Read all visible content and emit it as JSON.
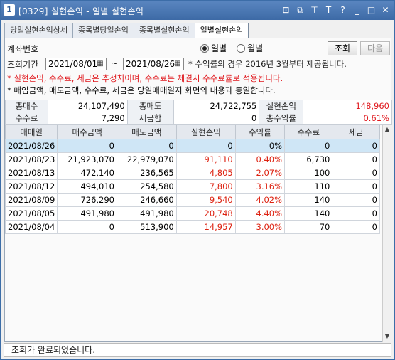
{
  "window": {
    "number": "1",
    "title": "[0329] 실현손익 - 일별 실현손익"
  },
  "tabs": [
    "당일실현손익상세",
    "종목별당일손익",
    "종목별실현손익",
    "일별실현손익"
  ],
  "form": {
    "account_label": "계좌번호",
    "period_label": "조회기간",
    "date_from": "2021/08/01",
    "date_to": "2021/08/26",
    "tilde": "~",
    "period_note": "* 수익률의 경우 2016년 3월부터 제공됩니다.",
    "radio_daily": "일별",
    "radio_monthly": "월별",
    "query_button": "조회",
    "next_button": "다음"
  },
  "notes": {
    "red": "* 실현손익, 수수료, 세금은 추정치이며, 수수료는 체결시 수수료률로 적용됩니다.",
    "normal": "* 매입금액, 매도금액, 수수료, 세금은 당일매매일지 화면의 내용과 동일합니다."
  },
  "summary": {
    "total_buy_label": "총매수",
    "total_buy": "24,107,490",
    "total_sell_label": "총매도",
    "total_sell": "24,722,755",
    "realized_label": "실현손익",
    "realized": "148,960",
    "fee_label": "수수료",
    "fee": "7,290",
    "tax_label": "세금합",
    "tax": "0",
    "yield_label": "총수익률",
    "yield": "0.61%"
  },
  "grid": {
    "headers": [
      "매매일",
      "매수금액",
      "매도금액",
      "실현손익",
      "수익률",
      "수수료",
      "세금"
    ],
    "rows": [
      [
        "2021/08/26",
        "0",
        "0",
        "0",
        "0%",
        "0",
        "0"
      ],
      [
        "2021/08/23",
        "21,923,070",
        "22,979,070",
        "91,110",
        "0.40%",
        "6,730",
        "0"
      ],
      [
        "2021/08/13",
        "472,140",
        "236,565",
        "4,805",
        "2.07%",
        "100",
        "0"
      ],
      [
        "2021/08/12",
        "494,010",
        "254,580",
        "7,800",
        "3.16%",
        "110",
        "0"
      ],
      [
        "2021/08/09",
        "726,290",
        "246,660",
        "9,540",
        "4.02%",
        "140",
        "0"
      ],
      [
        "2021/08/05",
        "491,980",
        "491,980",
        "20,748",
        "4.40%",
        "140",
        "0"
      ],
      [
        "2021/08/04",
        "0",
        "513,900",
        "14,957",
        "3.00%",
        "70",
        "0"
      ]
    ]
  },
  "status": "조회가 완료되었습니다.",
  "colors": {
    "title_bar": "#3d6aa6",
    "profit_red": "#d21111",
    "selected_row": "#cfe6f6"
  }
}
